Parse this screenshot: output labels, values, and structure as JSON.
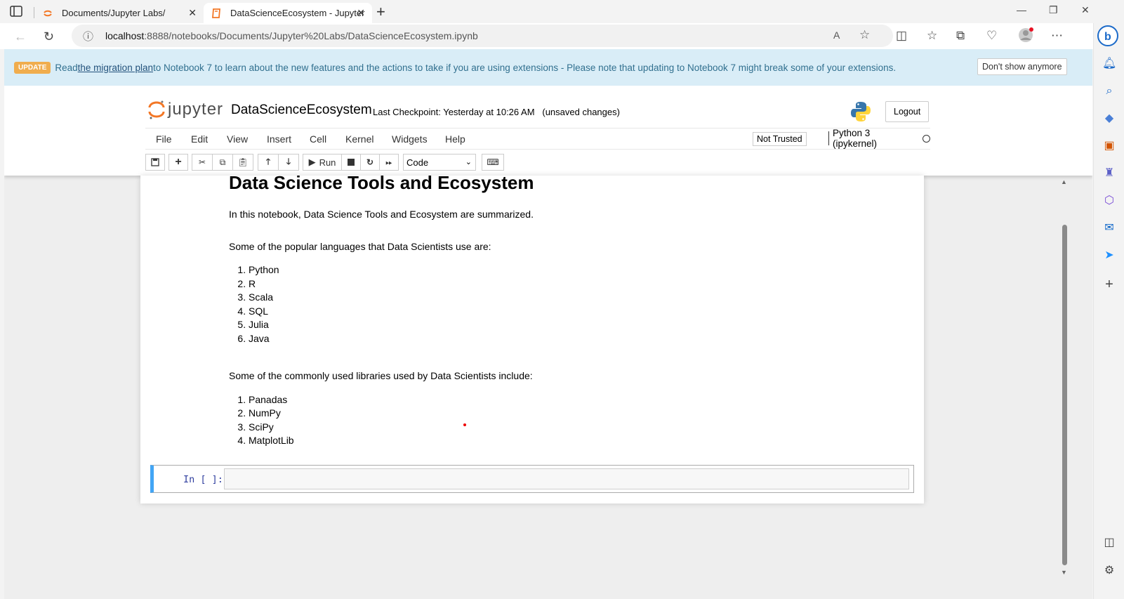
{
  "browser": {
    "tabs": [
      {
        "title": "Documents/Jupyter Labs/",
        "active": false
      },
      {
        "title": "DataScienceEcosystem - Jupyter",
        "active": true
      }
    ],
    "address": {
      "host": "localhost",
      "rest": ":8888/notebooks/Documents/Jupyter%20Labs/DataScienceEcosystem.ipynb"
    }
  },
  "banner": {
    "badge": "UPDATE",
    "pre": "Read ",
    "link": "the migration plan",
    "post": " to Notebook 7 to learn about the new features and the actions to take if you are using extensions - Please note that updating to Notebook 7 might break some of your extensions.",
    "dismiss": "Don't show anymore"
  },
  "header": {
    "logo": "jupyter",
    "notebook_name": "DataScienceEcosystem",
    "checkpoint": "Last Checkpoint: Yesterday at 10:26 AM   (unsaved changes)",
    "logout": "Logout"
  },
  "menubar": {
    "items": [
      "File",
      "Edit",
      "View",
      "Insert",
      "Cell",
      "Kernel",
      "Widgets",
      "Help"
    ],
    "trusted": "Not Trusted",
    "kernel": "Python 3 (ipykernel)"
  },
  "toolbar": {
    "run_label": "Run",
    "cell_type": "Code"
  },
  "notebook": {
    "heading": "Data Science Tools and Ecosystem",
    "intro": "In this notebook, Data Science Tools and Ecosystem are summarized.",
    "languages_intro": "Some of the popular languages that Data Scientists use are:",
    "languages": [
      "Python",
      "R",
      "Scala",
      "SQL",
      "Julia",
      "Java"
    ],
    "libraries_intro": "Some of the commonly used libraries used by Data Scientists include:",
    "libraries": [
      "Panadas",
      "NumPy",
      "SciPy",
      "MatplotLib"
    ],
    "prompt": "In [ ]:"
  }
}
